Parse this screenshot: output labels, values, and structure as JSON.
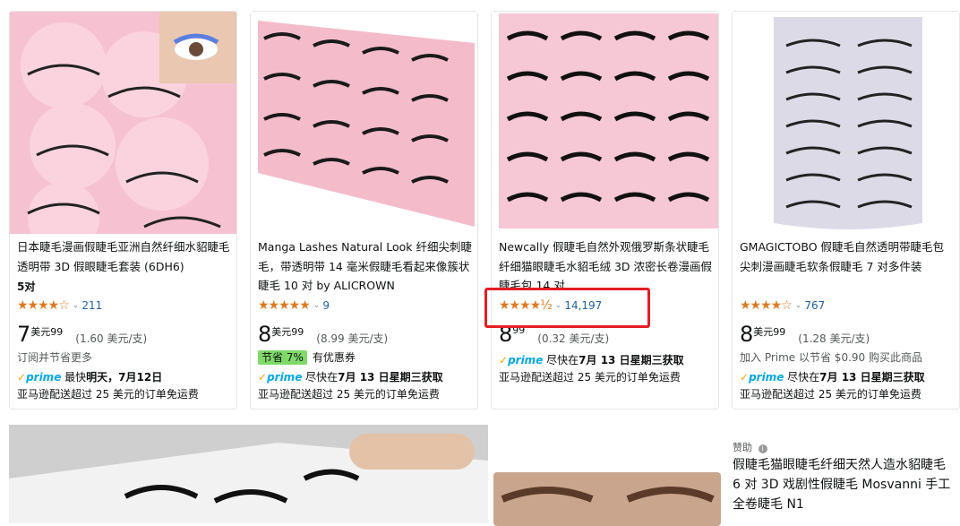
{
  "products": [
    {
      "title": "日本睫毛漫画假睫毛亚洲自然纤细水貂睫毛透明带 3D 假眼睫毛套装 (6DH6)",
      "extra": "5对",
      "stars": "★★★★☆",
      "rating_count": "211",
      "price_whole": "7",
      "price_sup": "美元99",
      "unit_price": "(1.60 美元/支)",
      "line1": "订阅并节省更多",
      "prime_label": "prime",
      "delivery_prefix": "最快",
      "delivery": "明天，7月12日",
      "shipping": "亚马逊配送超过 25 美元的订单免运费"
    },
    {
      "title": "Manga Lashes Natural Look 纤细尖刺睫毛，带透明带 14 毫米假睫毛看起来像簇状睫毛 10 对 by ALICROWN",
      "stars": "★★★★★",
      "rating_count": "9",
      "price_whole": "8",
      "price_sup": "美元99",
      "unit_price": "(8.99 美元/支)",
      "save_badge": "节省 7%",
      "coupon": "有优惠券",
      "prime_label": "prime",
      "delivery_prefix": "尽快在",
      "delivery": "7月 13 日星期三获取",
      "shipping": "亚马逊配送超过 25 美元的订单免运费"
    },
    {
      "title": "Newcally 假睫毛自然外观俄罗斯条状睫毛纤细猫眼睫毛水貂毛绒 3D 浓密长卷漫画假睫毛包 14 对",
      "stars": "★★★★½",
      "rating_count": "14,197",
      "price_whole": "8",
      "price_sup": "99",
      "unit_price": "(0.32 美元/支)",
      "prime_label": "prime",
      "delivery_prefix": "尽快在",
      "delivery": "7月 13 日星期三获取",
      "shipping": "亚马逊配送超过 25 美元的订单免运费"
    },
    {
      "title": "GMAGICTOBO 假睫毛自然透明带睫毛包尖刺漫画睫毛软条假睫毛 7 对多件装",
      "stars": "★★★★☆",
      "rating_count": "767",
      "price_whole": "8",
      "price_sup": "美元99",
      "unit_price": "(1.28 美元/支)",
      "line1": "加入 Prime 以节省 $0.90 购买此商品",
      "prime_label": "prime",
      "delivery_prefix": "尽快在",
      "delivery": "7月 13 日星期三获取",
      "shipping": "亚马逊配送超过 25 美元的订单免运费"
    }
  ],
  "sponsored": {
    "label": "赞助",
    "title": "假睫毛猫眼睫毛纤细天然人造水貂睫毛 6 对 3D 戏剧性假睫毛 Mosvanni 手工全卷睫毛 N1"
  }
}
